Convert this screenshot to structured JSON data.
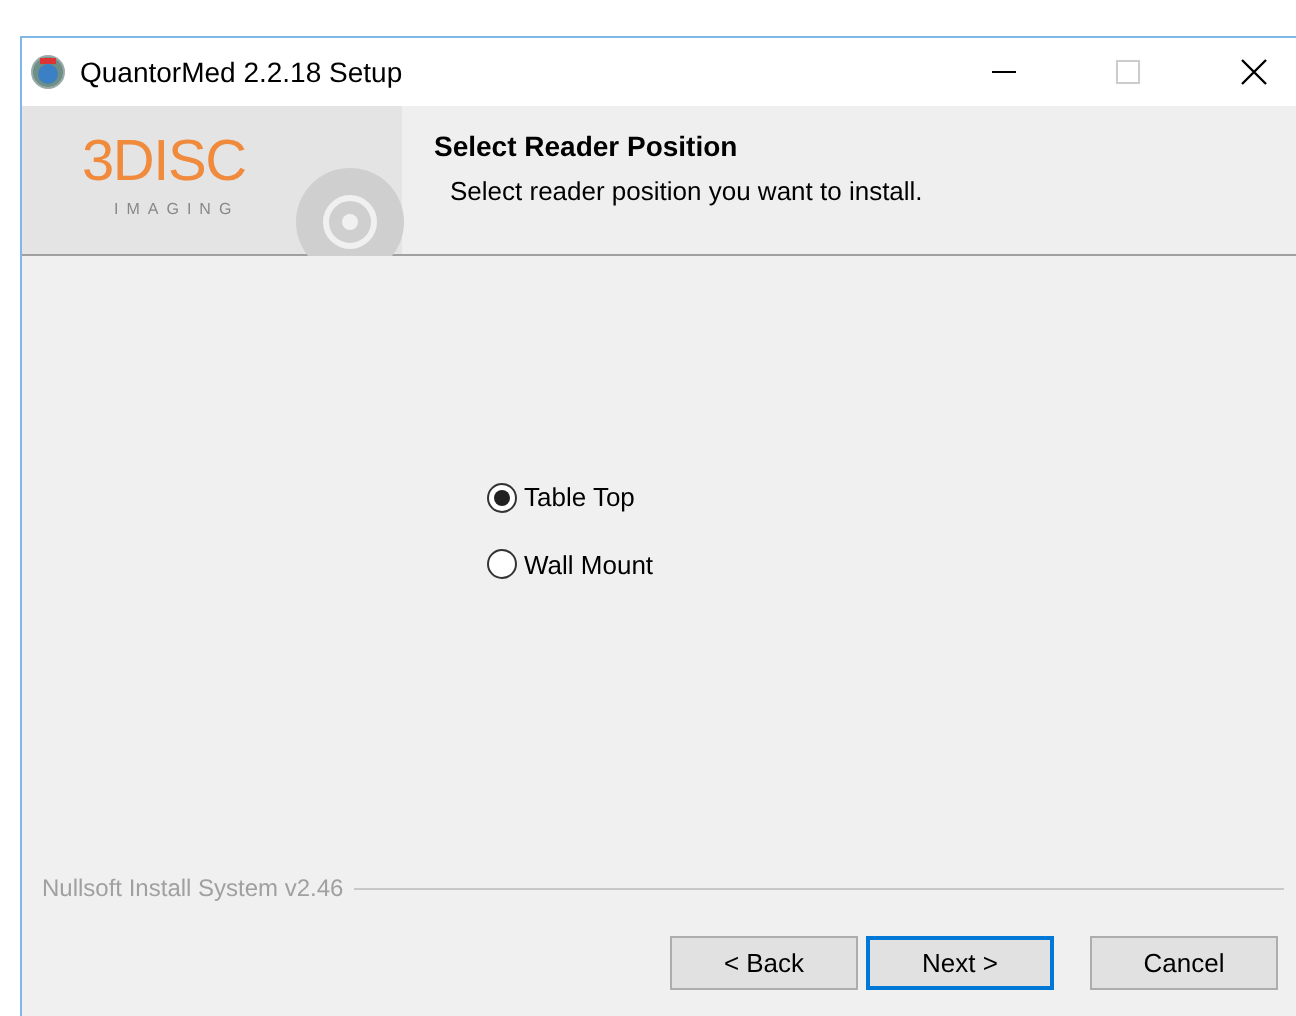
{
  "window": {
    "title": "QuantorMed 2.2.18 Setup"
  },
  "header": {
    "logo": "3DISC",
    "logo_sub": "IMAGING",
    "title": "Select Reader Position",
    "subtitle": "Select reader position you want to install."
  },
  "options": [
    {
      "label": "Table Top",
      "selected": true
    },
    {
      "label": "Wall Mount",
      "selected": false
    }
  ],
  "branding": "Nullsoft Install System v2.46",
  "buttons": [
    {
      "label": "< Back",
      "focused": false
    },
    {
      "label": "Next >",
      "focused": true
    },
    {
      "label": "Cancel",
      "focused": false
    }
  ]
}
